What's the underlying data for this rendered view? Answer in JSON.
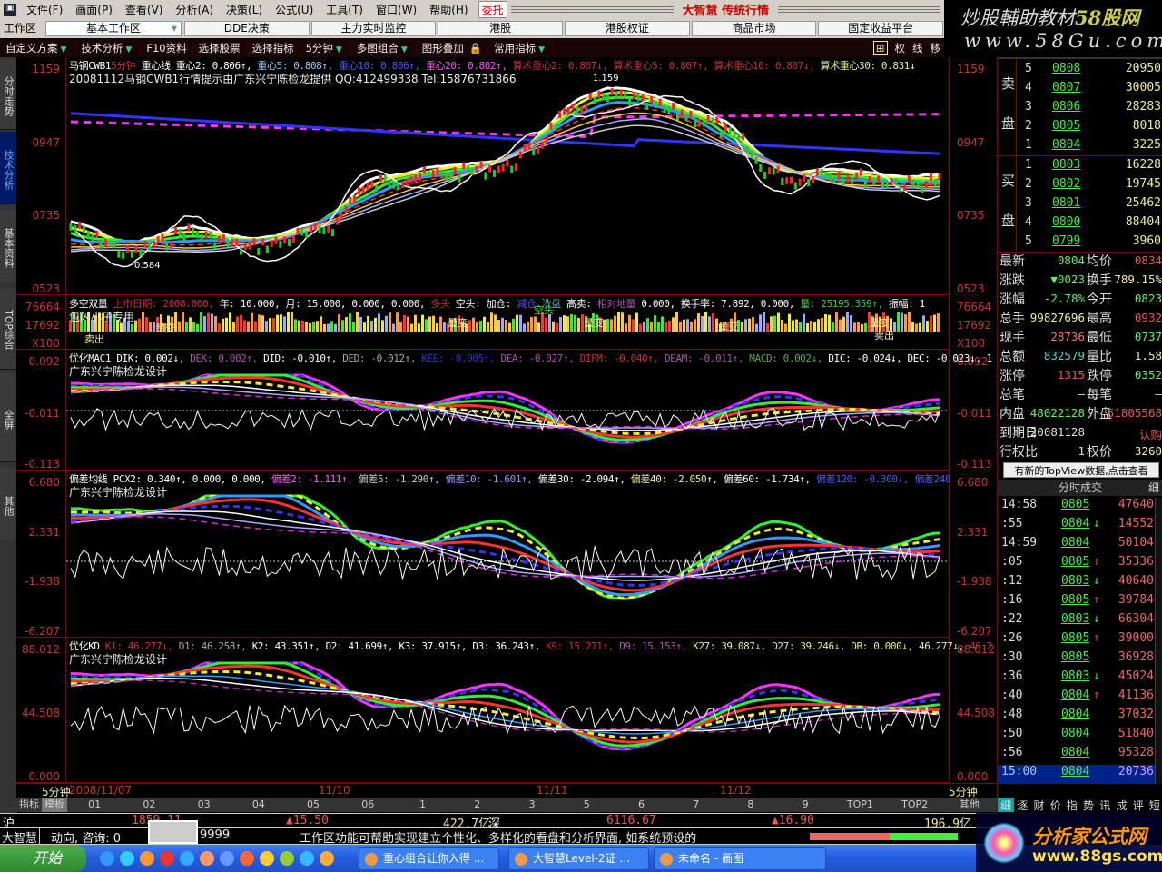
{
  "menu": {
    "items": [
      "文件(F)",
      "画面(P)",
      "查看(V)",
      "分析(A)",
      "决策(L)",
      "公式(U)",
      "工具(T)",
      "窗口(W)",
      "帮助(H)"
    ],
    "weituo": "委托",
    "brand": "大智慧 传统行情"
  },
  "tabs": {
    "label": "工作区",
    "selected": "基本工作区",
    "items": [
      "DDE决策",
      "主力实时监控",
      "港股",
      "港股权证",
      "商品市场",
      "固定收益平台"
    ]
  },
  "toolbar": {
    "items": [
      "自定义方案",
      "技术分析",
      "F10资料",
      "选择股票",
      "选择指标",
      "5分钟",
      "多图组合",
      "图形叠加",
      "常用指标"
    ],
    "right": [
      "权",
      "线",
      "移"
    ]
  },
  "watermark_top": {
    "line1": "炒股輔助教材",
    "line1b": "58股网",
    "line2": "www.58Gu.com"
  },
  "sidebar": [
    "分时走势",
    "技术分析",
    "基本资料",
    "TOP综合",
    "全屏",
    "其他"
  ],
  "panes": {
    "main": {
      "header": [
        [
          "马钢CWB1",
          "#fff"
        ],
        [
          "5分钟",
          "#c33"
        ],
        [
          " 重心线 重心2: 0.806↑,",
          "#fff"
        ],
        [
          " 重心5: 0.808↑,",
          "#9cf"
        ],
        [
          " 重心10: 0.806↑,",
          "#55f"
        ],
        [
          " 重心20: 0.802↑,",
          "#f5f"
        ],
        [
          " 算术重心2: 0.807↓,",
          "#c33"
        ],
        [
          " 算术重心5: 0.807↑,",
          "#c33"
        ],
        [
          " 算术重心10: 0.807↓,",
          "#c33"
        ],
        [
          " 算术重心30: 0.831↓",
          "#ee9"
        ]
      ],
      "sub": "20081112马钢CWB1行情提示由广东兴宁陈检龙提供 QQ:412499338 Tel:15876731866",
      "left_axis": [
        "1159",
        "0947",
        "0735",
        "0523"
      ],
      "annot_low": "0.584",
      "annot_high": "1.159"
    },
    "volume": {
      "header": [
        [
          "多空双量",
          "#fff"
        ],
        [
          " 上市日期: 2008.000,",
          "#c33"
        ],
        [
          " 年: 10.000, 月: 15.000, 0.000, 0.000,",
          "#fff"
        ],
        [
          " 多头",
          "#c33"
        ],
        [
          " 空头: 加仓:",
          "#fff"
        ],
        [
          " 减仓",
          "#55f"
        ],
        [
          " 洗盘",
          "#5aa"
        ],
        [
          " 高卖:",
          "#fff"
        ],
        [
          " 相对地量",
          "#a5a"
        ],
        [
          " 0.000, 换手率: 7.892, 0.000,",
          "#fff"
        ],
        [
          " 量: 25195.359↑,",
          "#4c4"
        ],
        [
          " 振幅: 1",
          "#fff"
        ]
      ],
      "sub": "包闪小子专用",
      "labels": [
        "量变",
        "量变",
        "量变",
        "量变",
        "量变",
        "卖出",
        "卖出",
        "空头"
      ],
      "left_axis": [
        "76664",
        "17692",
        "X100"
      ]
    },
    "macd": {
      "header": [
        [
          "优化MAC1 DIK: 0.002↓,",
          "#fff"
        ],
        [
          " DEK: 0.002↑,",
          "#a5a"
        ],
        [
          " DID: -0.010↑,",
          "#fff"
        ],
        [
          " DED: -0.012↑,",
          "#aaa"
        ],
        [
          " KEE: -0.005↑,",
          "#33c"
        ],
        [
          " DEA: -0.027↑,",
          "#a5a"
        ],
        [
          " DIFM: -0.040↑,",
          "#c33"
        ],
        [
          " DEAM: -0.011↑,",
          "#a5a"
        ],
        [
          " MACD: 0.002↓,",
          "#5a5"
        ],
        [
          " DIC: -0.024↓,",
          "#fff"
        ],
        [
          " DEC: -0.023↓, 1",
          "#fff"
        ]
      ],
      "sub": "广东兴宁陈检龙设计",
      "left_axis": [
        "0.092",
        "-0.011",
        "-0.113"
      ]
    },
    "bias": {
      "header": [
        [
          "偏差均线 PCX2: 0.340↑, 0.000, 0.000,",
          "#fff"
        ],
        [
          " 偏差2: -1.111↑,",
          "#f5f"
        ],
        [
          " 偏差5: -1.290↑,",
          "#ccc"
        ],
        [
          " 偏差10: -1.601↑,",
          "#99f"
        ],
        [
          " 偏差30: -2.094↑,",
          "#fff"
        ],
        [
          " 偏差40: -2.050↑,",
          "#ee9"
        ],
        [
          " 偏差60: -1.734↑,",
          "#fff"
        ],
        [
          " 偏差120: -0.300↓,",
          "#55f"
        ],
        [
          " 偏差240",
          "#55f"
        ]
      ],
      "sub": "广东兴宁陈检龙设计",
      "left_axis": [
        "6.680",
        "2.331",
        "-1.938",
        "-6.207"
      ]
    },
    "kd": {
      "header": [
        [
          "优化KD",
          "#fff"
        ],
        [
          " K1: 46.277↓,",
          "#c33"
        ],
        [
          " D1: 46.258↑,",
          "#aaa"
        ],
        [
          " K2: 43.351↑, D2: 41.699↑,",
          "#fff"
        ],
        [
          " K3: 37.915↑, D3: 36.243↑,",
          "#fff"
        ],
        [
          " K9: 15.271↑,",
          "#c33"
        ],
        [
          " D9: 15.153↑,",
          "#a5a"
        ],
        [
          " K27: 39.087↓, D27: 39.246↓, DB: 0.000↓, 46.277↓,",
          "#ee9"
        ],
        [
          " 46.2",
          "#c33"
        ]
      ],
      "sub": "广东兴宁陈检龙设计",
      "left_axis": [
        "88.012",
        "44.508",
        "0.000"
      ]
    }
  },
  "dateaxis": {
    "period": "5分钟",
    "dates": [
      "2008/11/07",
      "11/10",
      "11/11",
      "11/12"
    ]
  },
  "idxtabs": [
    "指标",
    "模板",
    "01",
    "02",
    "03",
    "04",
    "05",
    "06",
    "1",
    "2",
    "3",
    "5",
    "6",
    "7",
    "8",
    "9",
    "TOP1",
    "TOP2",
    "其他"
  ],
  "orderbook": {
    "sell_label": [
      "卖",
      "盘"
    ],
    "buy_label": [
      "买",
      "盘"
    ],
    "sell": [
      [
        "5",
        "0808",
        "20950"
      ],
      [
        "4",
        "0807",
        "30005"
      ],
      [
        "3",
        "0806",
        "28283"
      ],
      [
        "2",
        "0805",
        "8018"
      ],
      [
        "1",
        "0804",
        "3225"
      ]
    ],
    "buy": [
      [
        "1",
        "0803",
        "16228"
      ],
      [
        "2",
        "0802",
        "19745"
      ],
      [
        "3",
        "0801",
        "25462"
      ],
      [
        "4",
        "0800",
        "88404"
      ],
      [
        "5",
        "0799",
        "3960"
      ]
    ]
  },
  "stats": [
    [
      "最新",
      "0804",
      "#6e6",
      "均价",
      "0834",
      "#e55"
    ],
    [
      "涨跌",
      "▼0023",
      "#6e6",
      "换手",
      "789.15%",
      "#ee9"
    ],
    [
      "涨幅",
      "-2.78%",
      "#6e6",
      "今开",
      "0823",
      "#6e6"
    ],
    [
      "总手",
      "99827696",
      "#ee9",
      "最高",
      "0932",
      "#e55"
    ],
    [
      "现手",
      "28736",
      "#e77",
      "最低",
      "0737",
      "#6e6"
    ],
    [
      "总额",
      "832579",
      "#6cc",
      "量比",
      "1.58",
      "#ee9"
    ],
    [
      "涨停",
      "1315",
      "#e55",
      "跌停",
      "0352",
      "#6e6"
    ],
    [
      "总笔",
      "—",
      "#ddd",
      "每笔",
      "—",
      "#ddd"
    ],
    [
      "内盘",
      "48022128",
      "#6e6",
      "外盘",
      "51805568",
      "#e55"
    ],
    [
      "到期日",
      "20081128",
      "#ddd",
      "",
      "认购",
      "#e55"
    ],
    [
      "行权比",
      "1",
      "#ddd",
      "权价",
      "3260",
      "#ee9"
    ]
  ],
  "topview": "有新的TopView数据,点击查看",
  "trades": {
    "title": "分时成交",
    "detail": "细",
    "rows": [
      [
        "14:58",
        "0805",
        "",
        "47640"
      ],
      [
        ":55",
        "0804",
        "↓",
        "14552"
      ],
      [
        "14:59",
        "0804",
        "",
        "50104"
      ],
      [
        ":05",
        "0805",
        "↑",
        "35336"
      ],
      [
        ":12",
        "0803",
        "↓",
        "40640"
      ],
      [
        ":16",
        "0805",
        "↑",
        "39784"
      ],
      [
        ":22",
        "0803",
        "↓",
        "66304"
      ],
      [
        ":26",
        "0805",
        "↑",
        "39000"
      ],
      [
        ":30",
        "0805",
        "",
        "36928"
      ],
      [
        ":36",
        "0803",
        "↓",
        "45024"
      ],
      [
        ":40",
        "0804",
        "↑",
        "41136"
      ],
      [
        ":48",
        "0804",
        "",
        "37032"
      ],
      [
        ":50",
        "0804",
        "",
        "51840"
      ],
      [
        ":56",
        "0804",
        "",
        "95328"
      ],
      [
        "15:00",
        "0804",
        "",
        "20736"
      ]
    ]
  },
  "rtabs": [
    "细",
    "逐",
    "财",
    "价",
    "指",
    "势",
    "讯",
    "成",
    "评",
    "短"
  ],
  "status": {
    "sh_label": "沪",
    "sh_index": "1859.11",
    "sh_change": "▲15.50",
    "sh_amount": "422.7亿",
    "sz_label": "深",
    "sz_index": "6116.67",
    "sz_change": "▲16.90",
    "sz_amount": "196.9亿"
  },
  "ticker": {
    "left": "大智慧",
    "text1": "动向, 咨询: 0",
    "text2": "9999",
    "text3": "工作区功能可帮助实现建立个性化、多样化的看盘和分析界面, 如系统预设的"
  },
  "taskbar": {
    "start": "开始",
    "tasks": [
      "重心组合让你入得 ...",
      "大智慧Level-2证 ...",
      "未命名 - 画图"
    ]
  },
  "watermark_bottom": {
    "line1": "分析家公式网",
    "line2": "www.88gs.com"
  }
}
